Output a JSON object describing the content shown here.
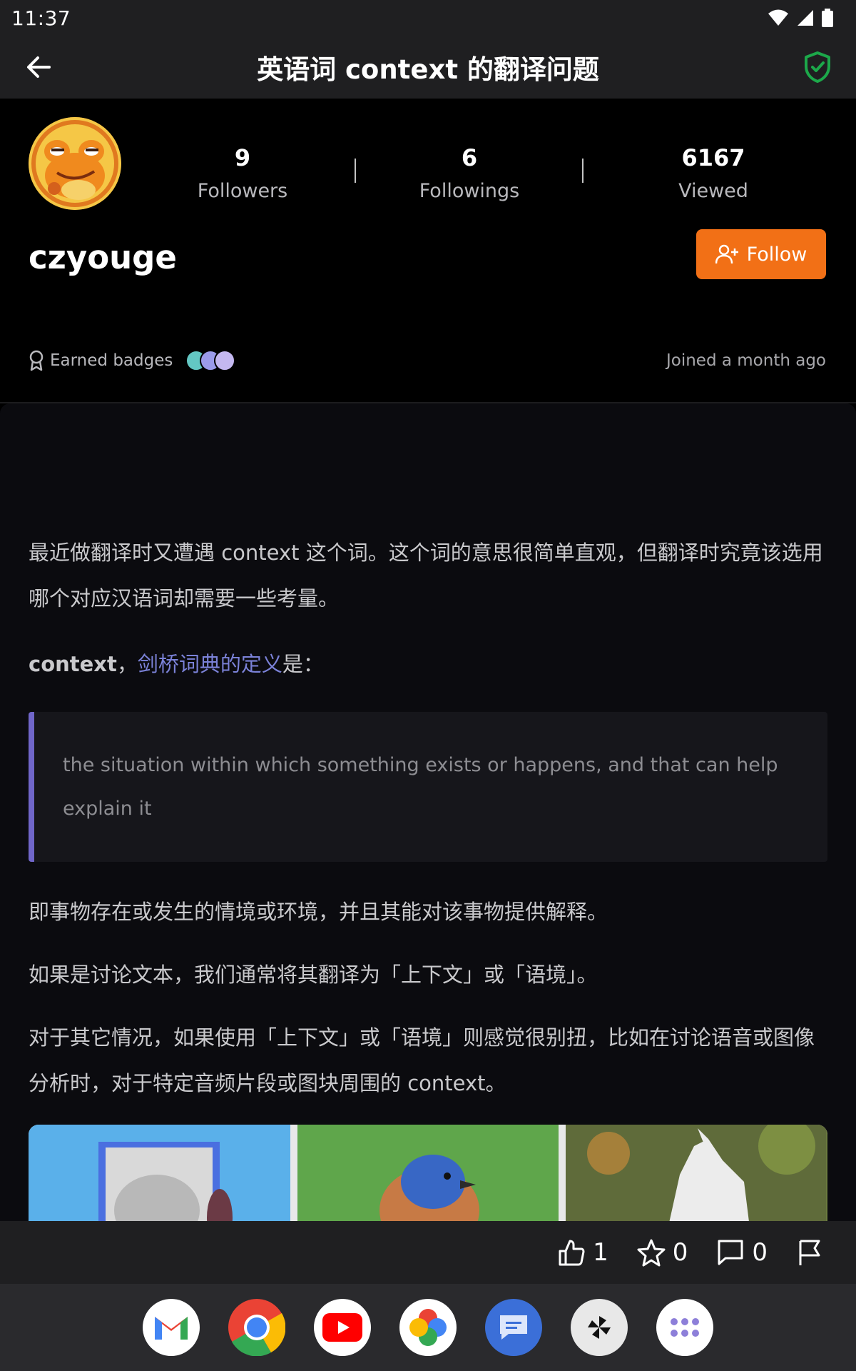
{
  "status": {
    "time": "11:37"
  },
  "header": {
    "title": "英语词 context 的翻译问题"
  },
  "profile": {
    "username": "czyouge",
    "stats": [
      {
        "value": "9",
        "label": "Followers"
      },
      {
        "value": "6",
        "label": "Followings"
      },
      {
        "value": "6167",
        "label": "Viewed"
      }
    ],
    "follow_label": "Follow",
    "badges_label": "Earned badges",
    "joined": "Joined a month ago",
    "colors": {
      "accent": "#f27016"
    }
  },
  "article": {
    "p1": "最近做翻译时又遭遇 context 这个词。这个词的意思很简单直观，但翻译时究竟该选用哪个对应汉语词却需要一些考量。",
    "def_term": "context",
    "def_sep": "，",
    "def_link": "剑桥词典的定义",
    "def_suffix": "是：",
    "quote": "the situation within which something exists or happens, and that can help explain it",
    "p2": "即事物存在或发生的情境或环境，并且其能对该事物提供解释。",
    "p3": "如果是讨论文本，我们通常将其翻译为「上下文」或「语境」。",
    "p4": "对于其它情况，如果使用「上下文」或「语境」则感觉很别扭，比如在讨论语音或图像分析时，对于特定音频片段或图块周围的 context。"
  },
  "actions": {
    "likes": "1",
    "stars": "0",
    "comments": "0"
  },
  "dock": {
    "apps": [
      "gmail-icon",
      "chrome-icon",
      "youtube-icon",
      "photos-icon",
      "messages-icon",
      "pinwheel-icon",
      "app-drawer-icon"
    ]
  }
}
